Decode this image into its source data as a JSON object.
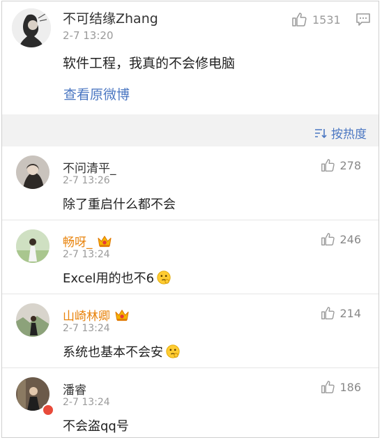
{
  "post": {
    "author": "不可结缘Zhang",
    "time": "2-7 13:20",
    "likes": "1531",
    "text": "软件工程，我真的不会修电脑",
    "view_original": "查看原微博"
  },
  "sort_label": "按热度",
  "comments": [
    {
      "author": "不问清平_",
      "time": "2-7 13:26",
      "likes": "278",
      "text": "除了重启什么都不会",
      "vip": false,
      "emoji": false
    },
    {
      "author": "畅呀_",
      "time": "2-7 13:24",
      "likes": "246",
      "text": "Excel用的也不6",
      "vip": true,
      "emoji": true
    },
    {
      "author": "山崎林卿",
      "time": "2-7 13:24",
      "likes": "214",
      "text": "系统也基本不会安",
      "vip": true,
      "emoji": true
    },
    {
      "author": "潘睿",
      "time": "2-7 13:24",
      "likes": "186",
      "text": "不会盗qq号",
      "vip": false,
      "emoji": false
    }
  ],
  "colors": {
    "link": "#4b77c2",
    "vip_name": "#e8830c",
    "meta_gray": "#9a9a9a"
  }
}
